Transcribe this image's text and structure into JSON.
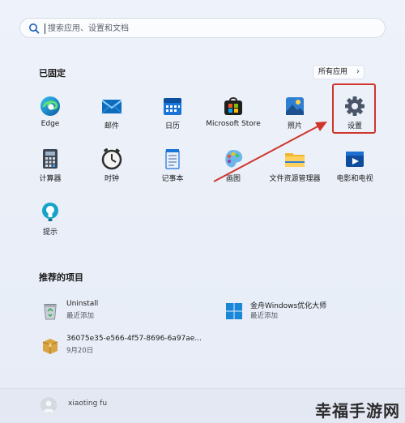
{
  "search": {
    "placeholder": "搜索应用、设置和文档"
  },
  "pinned": {
    "title": "已固定",
    "all_apps_label": "所有应用",
    "apps": [
      {
        "label": "Edge",
        "icon": "edge-icon"
      },
      {
        "label": "邮件",
        "icon": "mail-icon"
      },
      {
        "label": "日历",
        "icon": "calendar-icon"
      },
      {
        "label": "Microsoft Store",
        "icon": "store-icon"
      },
      {
        "label": "照片",
        "icon": "photos-icon"
      },
      {
        "label": "设置",
        "icon": "settings-gear-icon"
      },
      {
        "label": "计算器",
        "icon": "calculator-icon"
      },
      {
        "label": "时钟",
        "icon": "clock-icon"
      },
      {
        "label": "记事本",
        "icon": "notepad-icon"
      },
      {
        "label": "画图",
        "icon": "paint-icon"
      },
      {
        "label": "文件资源管理器",
        "icon": "folder-icon"
      },
      {
        "label": "电影和电视",
        "icon": "movies-icon"
      },
      {
        "label": "提示",
        "icon": "tips-icon"
      }
    ]
  },
  "recommended": {
    "title": "推荐的项目",
    "items": [
      {
        "name": "Uninstall",
        "sub": "最近添加",
        "icon": "recycle-bin-icon"
      },
      {
        "name": "金舟Windows优化大师",
        "sub": "最近添加",
        "icon": "windows-logo-icon"
      },
      {
        "name": "36075e35-e566-4f57-8696-6a97ae...",
        "sub": "9月20日",
        "icon": "package-icon"
      }
    ]
  },
  "user": {
    "name": "xiaoting fu"
  },
  "watermark": "幸福手游网",
  "colors": {
    "highlight": "#d0352b",
    "accent": "#0067c0"
  }
}
